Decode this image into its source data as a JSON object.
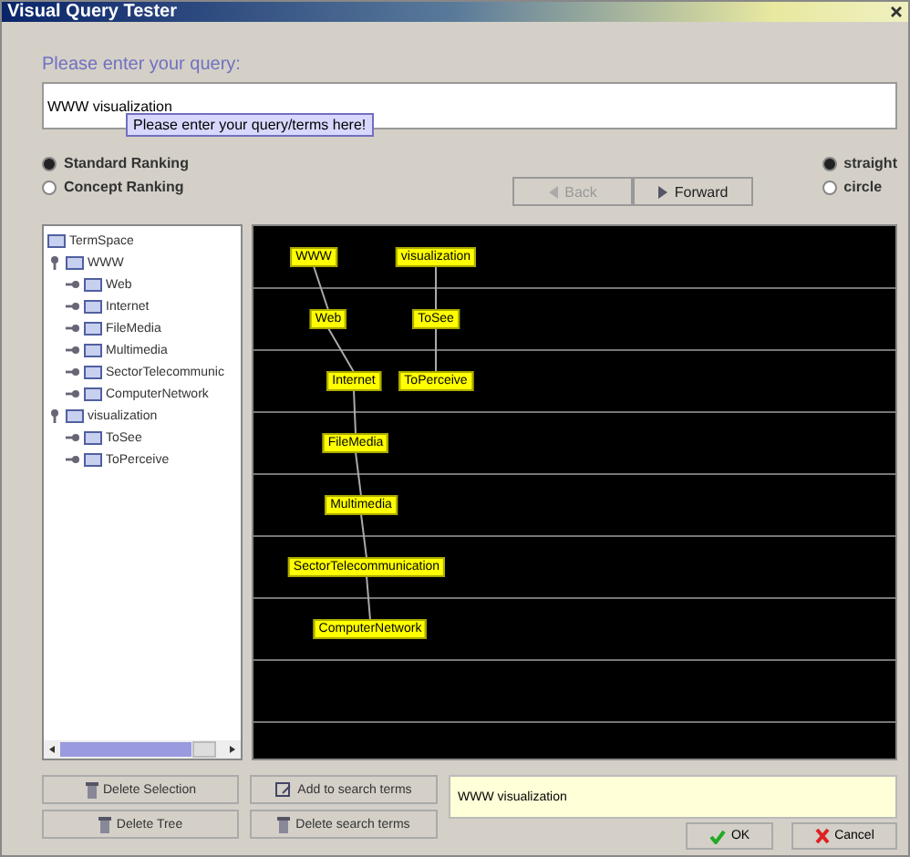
{
  "window": {
    "title": "Visual Query Tester"
  },
  "query": {
    "label": "Please enter your query:",
    "value": "WWW visualization",
    "tooltip": "Please enter your query/terms here!"
  },
  "ranking": [
    {
      "label": "Standard Ranking",
      "selected": true
    },
    {
      "label": "Concept Ranking",
      "selected": false
    }
  ],
  "navigation": [
    {
      "label": "Back",
      "kind": "back",
      "disabled": true
    },
    {
      "label": "Forward",
      "kind": "forward",
      "disabled": false
    }
  ],
  "line_style": [
    {
      "label": "straight",
      "selected": true
    },
    {
      "label": "circle",
      "selected": false
    }
  ],
  "tree": {
    "label": "TermSpace",
    "children": [
      {
        "label": "WWW",
        "expanded": true,
        "children": [
          {
            "label": "Web",
            "expanded": false
          },
          {
            "label": "Internet",
            "expanded": false
          },
          {
            "label": "FileMedia",
            "expanded": false
          },
          {
            "label": "Multimedia",
            "expanded": false
          },
          {
            "label": "SectorTelecommunic",
            "expanded": false
          },
          {
            "label": "ComputerNetwork",
            "expanded": false
          }
        ]
      },
      {
        "label": "visualization",
        "expanded": true,
        "children": [
          {
            "label": "ToSee",
            "expanded": false
          },
          {
            "label": "ToPerceive",
            "expanded": false
          }
        ]
      }
    ]
  },
  "graph": {
    "chains": [
      [
        "WWW",
        "Web",
        "Internet",
        "FileMedia",
        "Multimedia",
        "SectorTelecommunication",
        "ComputerNetwork"
      ],
      [
        "visualization",
        "ToSee",
        "ToPerceive"
      ]
    ]
  },
  "actions": [
    {
      "label": "Delete Selection",
      "kind": "trash"
    },
    {
      "label": "Delete Tree",
      "kind": "trash"
    },
    {
      "label": "Add to search terms",
      "kind": "add"
    },
    {
      "label": "Delete search terms",
      "kind": "trash"
    }
  ],
  "search_terms": "WWW visualization",
  "dialog_buttons": [
    {
      "label": "OK",
      "kind": "ok"
    },
    {
      "label": "Cancel",
      "kind": "cancel"
    }
  ]
}
